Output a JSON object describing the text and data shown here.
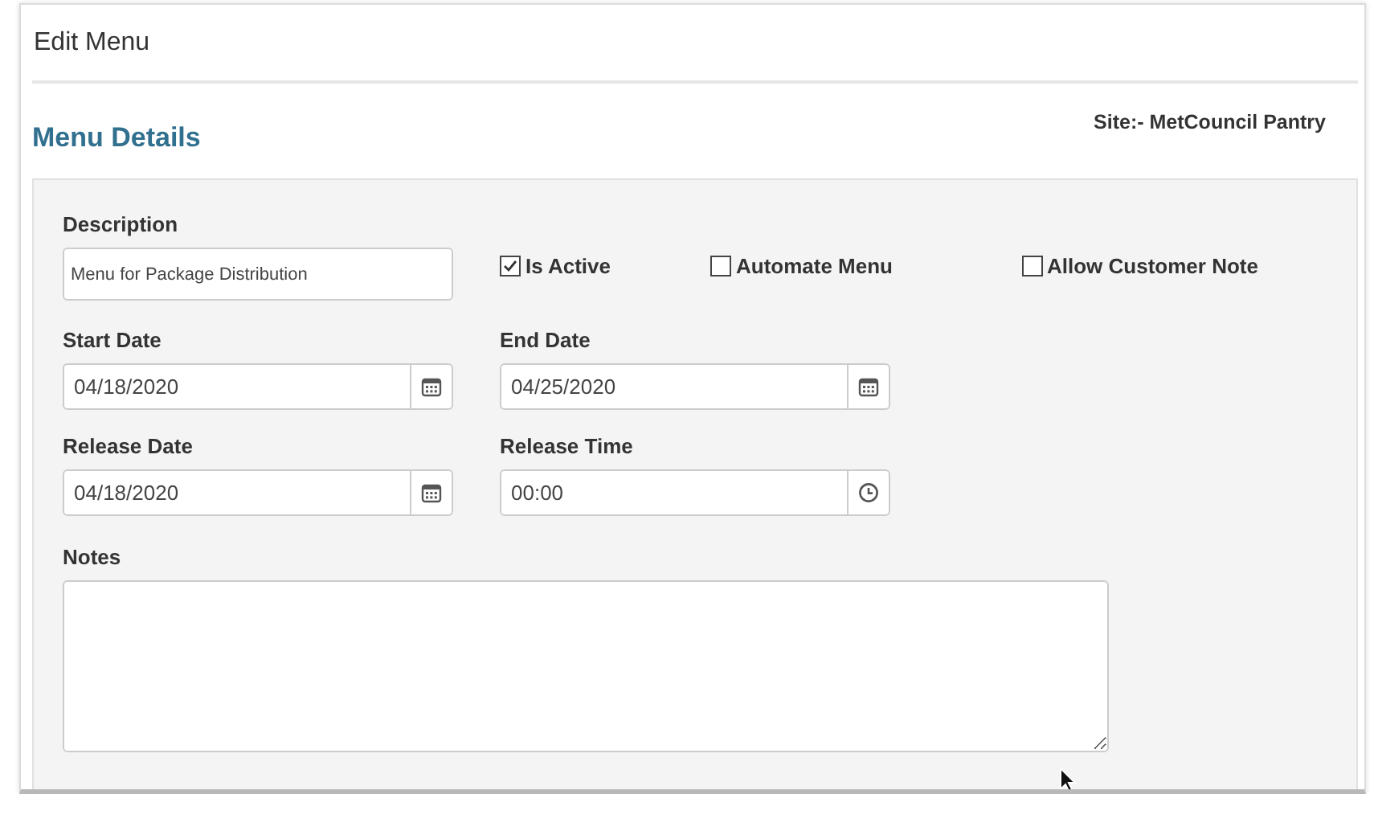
{
  "window": {
    "title": "Edit Menu"
  },
  "section": {
    "title": "Menu Details",
    "site": "Site:- MetCouncil Pantry"
  },
  "description": {
    "label": "Description",
    "value": "Menu for Package Distribution"
  },
  "checkboxes": [
    {
      "label": "Is Active",
      "checked": true
    },
    {
      "label": "Automate Menu",
      "checked": false
    },
    {
      "label": "Allow Customer Note",
      "checked": false
    }
  ],
  "fields": [
    {
      "label": "Start Date",
      "value": "04/18/2020",
      "kind": "date"
    },
    {
      "label": "End Date",
      "value": "04/25/2020",
      "kind": "date"
    },
    {
      "label": "Release Date",
      "value": "04/18/2020",
      "kind": "date"
    },
    {
      "label": "Release Time",
      "value": "00:00",
      "kind": "time"
    }
  ],
  "notes": {
    "label": "Notes"
  }
}
